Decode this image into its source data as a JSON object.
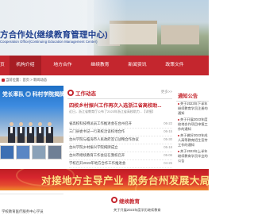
{
  "header": {
    "title": "方合作处(继续教育管理中心)",
    "subtitle": "Cooperation Office(Continuing Education Management Center)"
  },
  "nav": {
    "items": [
      {
        "label": "首页",
        "active": false
      },
      {
        "label": "机构介绍",
        "active": true
      },
      {
        "label": "地方合作",
        "active": false
      },
      {
        "label": "继续教育",
        "active": false
      },
      {
        "label": "新闻资讯",
        "active": false
      },
      {
        "label": "政策文件",
        "active": false
      }
    ]
  },
  "breadcrumb": {
    "text": "当前位置：首页 > 新闻动态"
  },
  "slider": {
    "caption": "党长率队 ◎ 科村学院揭牌"
  },
  "news": {
    "section_title": "工作动态",
    "more_label": "更多>>",
    "headline": "四校乡村振兴工作再次入选浙江省高校助...",
    "summary": "近日，浙江省教育厅公布了2023年浙江省高校助力...【详细】",
    "items": [
      {
        "title": "省高校科技特派员工作推进会在台州召开",
        "date": "06-22"
      },
      {
        "title": "三门县委书记一行来校洽谈校地合作",
        "date": "06-15"
      },
      {
        "title": "台州学院与临海市人民政府签订战略合作协议",
        "date": "05-30"
      },
      {
        "title": "台州学院乡村振兴学院揭牌成立",
        "date": "05-18"
      },
      {
        "title": "台州市继续教育工作会议在我校召开",
        "date": "05-06"
      },
      {
        "title": "学校召开2023年地方合作工作推进会",
        "date": "04-25"
      }
    ]
  },
  "notices": {
    "title": "通知公告",
    "items": [
      "关于2023年下半年继续教育学员注册的通知",
      "关于开展2023年度校地合作项目申报工作的通知",
      "关于做好2023年成人高等教育招生宣传工作的通知",
      "关于2023年上半年继续教育学员毕业的公告"
    ]
  },
  "banner": {
    "text": "对接地方主导产业 服务台州发展大局"
  },
  "bottom": {
    "left_item": "学校教育医疗服务中心学员",
    "section_title": "继续教育",
    "item": "关于开展2023年度学历继续教育"
  },
  "colors": {
    "brand_red": "#c4262e",
    "title_blue": "#1e3f8f",
    "banner_gold": "#ffe28a"
  }
}
